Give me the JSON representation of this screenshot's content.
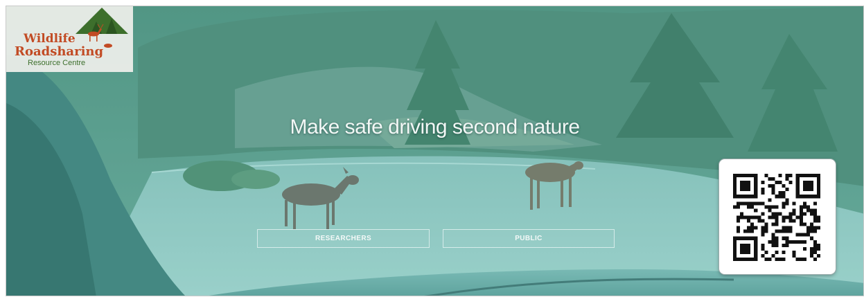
{
  "brand": {
    "line1": "Wildlife",
    "line2": "Roadsharing",
    "line3": "Resource Centre"
  },
  "hero": {
    "headline": "Make safe driving second nature"
  },
  "buttons": {
    "researchers": "RESEARCHERS",
    "public": "PUBLIC"
  },
  "colors": {
    "tint": "#5fb6a6",
    "logo_text": "#c24b24",
    "logo_green": "#3d6f2c"
  },
  "icons": {
    "logo": "deer-tree-logo-icon",
    "qr": "qr-code-icon"
  }
}
